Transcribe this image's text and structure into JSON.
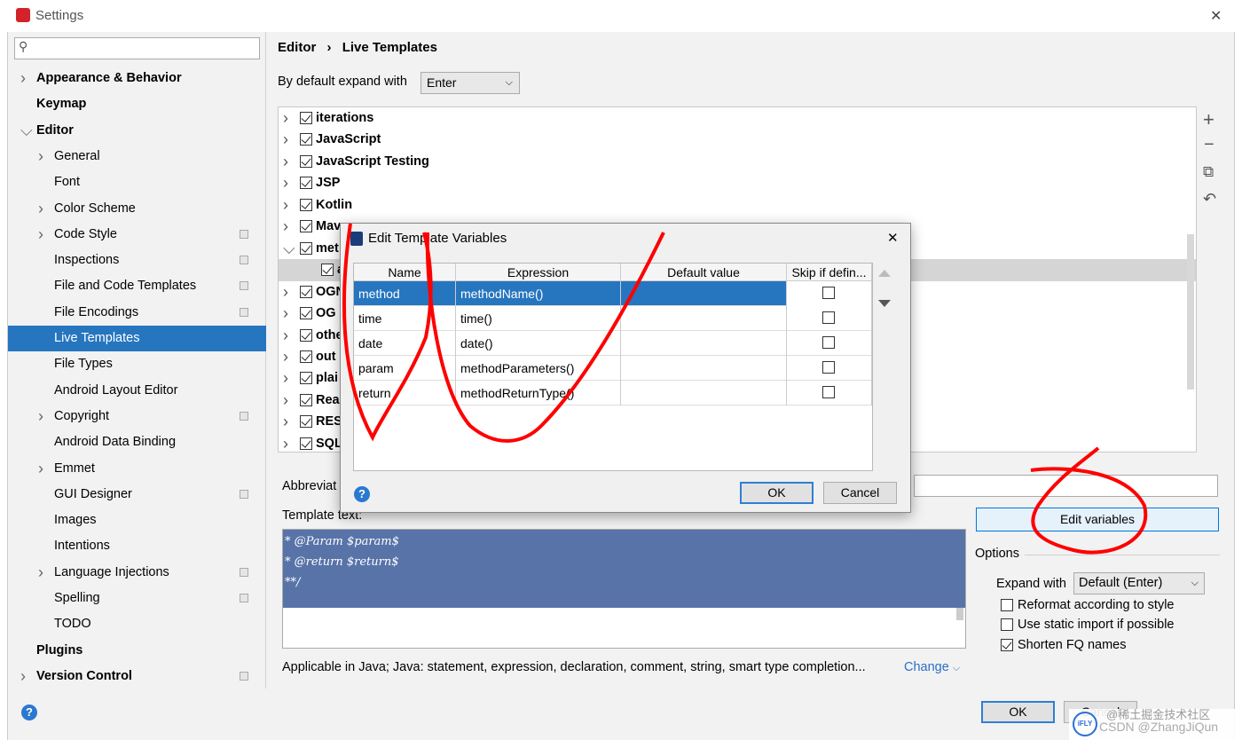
{
  "window": {
    "title": "Settings",
    "close": "✕"
  },
  "search": {
    "placeholder": "",
    "icon": "search-icon"
  },
  "sidebar": {
    "items": [
      {
        "label": "Appearance & Behavior",
        "level": 0,
        "bold": true,
        "chevron": "right"
      },
      {
        "label": "Keymap",
        "level": 0,
        "bold": true
      },
      {
        "label": "Editor",
        "level": 0,
        "bold": true,
        "chevron": "down"
      },
      {
        "label": "General",
        "level": 1,
        "chevron": "right"
      },
      {
        "label": "Font",
        "level": 1
      },
      {
        "label": "Color Scheme",
        "level": 1,
        "chevron": "right"
      },
      {
        "label": "Code Style",
        "level": 1,
        "chevron": "right",
        "project": true
      },
      {
        "label": "Inspections",
        "level": 1,
        "project": true
      },
      {
        "label": "File and Code Templates",
        "level": 1,
        "project": true
      },
      {
        "label": "File Encodings",
        "level": 1,
        "project": true
      },
      {
        "label": "Live Templates",
        "level": 1,
        "selected": true
      },
      {
        "label": "File Types",
        "level": 1
      },
      {
        "label": "Android Layout Editor",
        "level": 1
      },
      {
        "label": "Copyright",
        "level": 1,
        "chevron": "right",
        "project": true
      },
      {
        "label": "Android Data Binding",
        "level": 1
      },
      {
        "label": "Emmet",
        "level": 1,
        "chevron": "right"
      },
      {
        "label": "GUI Designer",
        "level": 1,
        "project": true
      },
      {
        "label": "Images",
        "level": 1
      },
      {
        "label": "Intentions",
        "level": 1
      },
      {
        "label": "Language Injections",
        "level": 1,
        "chevron": "right",
        "project": true
      },
      {
        "label": "Spelling",
        "level": 1,
        "project": true
      },
      {
        "label": "TODO",
        "level": 1
      },
      {
        "label": "Plugins",
        "level": 0,
        "bold": true
      },
      {
        "label": "Version Control",
        "level": 0,
        "bold": true,
        "chevron": "right",
        "project": true
      }
    ]
  },
  "breadcrumb": {
    "parent": "Editor",
    "sep": "›",
    "current": "Live Templates"
  },
  "expand_default": {
    "label": "By default expand with",
    "value": "Enter"
  },
  "template_groups": [
    {
      "label": "iterations",
      "chevron": "right"
    },
    {
      "label": "JavaScript",
      "chevron": "right"
    },
    {
      "label": "JavaScript Testing",
      "chevron": "right"
    },
    {
      "label": "JSP",
      "chevron": "right"
    },
    {
      "label": "Kotlin",
      "chevron": "right"
    },
    {
      "label": "Mav",
      "chevron": "right"
    },
    {
      "label": "met",
      "chevron": "down"
    },
    {
      "label": "a",
      "child": true
    },
    {
      "label": "OGN",
      "chevron": "right"
    },
    {
      "label": "OG",
      "chevron": "right"
    },
    {
      "label": "othe",
      "chevron": "right"
    },
    {
      "label": "out",
      "chevron": "right"
    },
    {
      "label": "plai",
      "chevron": "right"
    },
    {
      "label": "Rea",
      "chevron": "right"
    },
    {
      "label": "RES",
      "chevron": "right"
    },
    {
      "label": "SQL",
      "chevron": "right"
    }
  ],
  "toolbar": {
    "add": "+",
    "remove": "−",
    "copy": "⧉",
    "restore": "↶"
  },
  "abbreviation": {
    "label": "Abbreviat",
    "value": ""
  },
  "template_text": {
    "label": "Template text:",
    "lines": [
      "* @Param $param$",
      "* @return $return$",
      "**/"
    ]
  },
  "edit_variables": {
    "label": "Edit variables"
  },
  "options": {
    "title": "Options",
    "expand_label": "Expand with",
    "expand_value": "Default (Enter)",
    "checks": [
      {
        "label": "Reformat according to style",
        "checked": false
      },
      {
        "label": "Use static import if possible",
        "checked": false
      },
      {
        "label": "Shorten FQ names",
        "checked": true
      }
    ]
  },
  "applicable": {
    "text": "Applicable in Java; Java: statement, expression, declaration, comment, string, smart type completion...",
    "link": "Change"
  },
  "footer": {
    "ok": "OK",
    "cancel": "Cancel"
  },
  "dialog": {
    "title": "Edit Template Variables",
    "close": "✕",
    "columns": [
      "Name",
      "Expression",
      "Default value",
      "Skip if defin..."
    ],
    "rows": [
      {
        "name": "method",
        "expression": "methodName()",
        "default": "",
        "skip": false,
        "selected": true
      },
      {
        "name": "time",
        "expression": "time()",
        "default": "",
        "skip": false
      },
      {
        "name": "date",
        "expression": "date()",
        "default": "",
        "skip": false
      },
      {
        "name": "param",
        "expression": "methodParameters()",
        "default": "",
        "skip": false
      },
      {
        "name": "return",
        "expression": "methodReturnType()",
        "default": "",
        "skip": false
      }
    ],
    "ok": "OK",
    "cancel": "Cancel",
    "help": "?"
  },
  "watermark": {
    "text": "@稀土掘金技术社区",
    "credit": "CSDN @ZhangJiQun",
    "logo": "iFLY"
  },
  "colors": {
    "selection": "#2675bf",
    "annotation": "#ff0000",
    "template_bg": "#5873a8"
  }
}
